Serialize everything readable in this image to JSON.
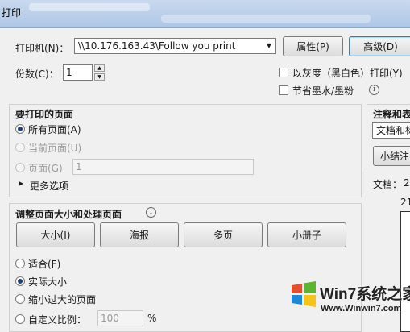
{
  "window": {
    "title": "打印"
  },
  "printer": {
    "label": "打印机(N)：",
    "selected": "\\\\10.176.163.43\\Follow you print",
    "properties_button": "属性(P)",
    "advanced_button": "高级(D)"
  },
  "copies": {
    "label": "份数(C)：",
    "value": "1"
  },
  "options": {
    "grayscale_label": "以灰度（黑白色）打印(Y)",
    "save_ink_label": "节省墨水/墨粉"
  },
  "pages_to_print": {
    "title": "要打印的页面",
    "all_pages": "所有页面(A)",
    "current_page": "当前页面(U)",
    "pages": "页面(G)",
    "pages_value": "1",
    "more_options": "更多选项"
  },
  "page_sizing": {
    "title": "调整页面大小和处理页面",
    "buttons": [
      "大小(I)",
      "海报",
      "多页",
      "小册子"
    ],
    "fit": "适合(F)",
    "actual_size": "实际大小",
    "shrink_oversized": "缩小过大的页面",
    "custom_scale": "自定义比例：",
    "custom_scale_value": "100",
    "percent": "%"
  },
  "comments_forms": {
    "title": "注释和表",
    "select_value": "文档和标",
    "summarize_button": "小结注"
  },
  "preview": {
    "document_label": "文档：",
    "document_value": "2",
    "size_label": "21"
  },
  "watermark": {
    "brand": "Win7系统之家",
    "url": "Www.Winwin7.com"
  }
}
